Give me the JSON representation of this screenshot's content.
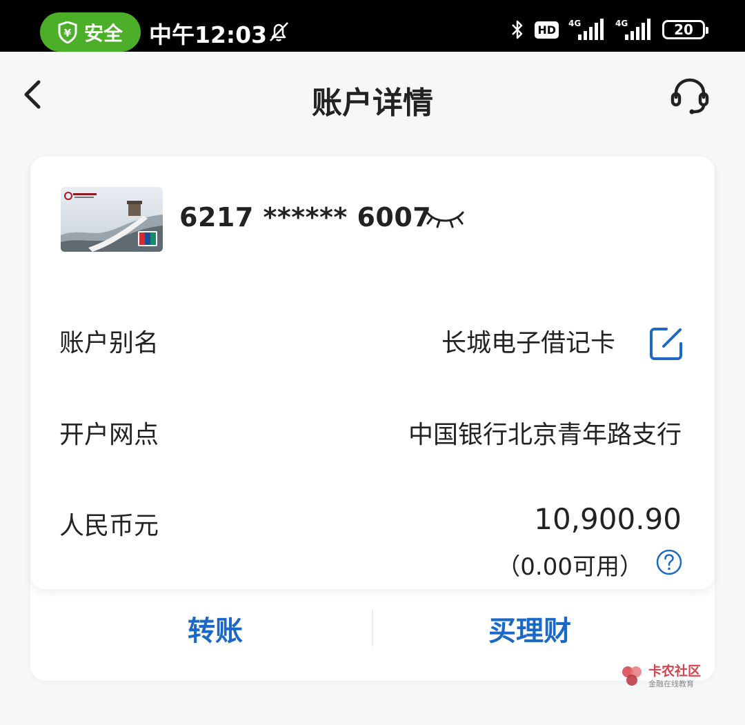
{
  "status_bar": {
    "safe_label": "安全",
    "time": "中午12:03",
    "hd_label": "HD",
    "network1": "4G",
    "network2": "4G",
    "battery": "20"
  },
  "header": {
    "title": "账户详情"
  },
  "account": {
    "card_number": "6217 ****** 6007",
    "alias_label": "账户别名",
    "alias_value": "长城电子借记卡",
    "branch_label": "开户网点",
    "branch_value": "中国银行北京青年路支行",
    "currency_label": "人民币元",
    "balance": "10,900.90",
    "available": "（0.00可用）"
  },
  "actions": {
    "transfer": "转账",
    "buy_wealth": "买理财"
  },
  "watermark": {
    "name": "卡农社区",
    "slogan": "金融在线教育"
  },
  "colors": {
    "accent_blue": "#1a68c7",
    "safe_green": "#4caf2a",
    "watermark_red": "#d6434c"
  }
}
